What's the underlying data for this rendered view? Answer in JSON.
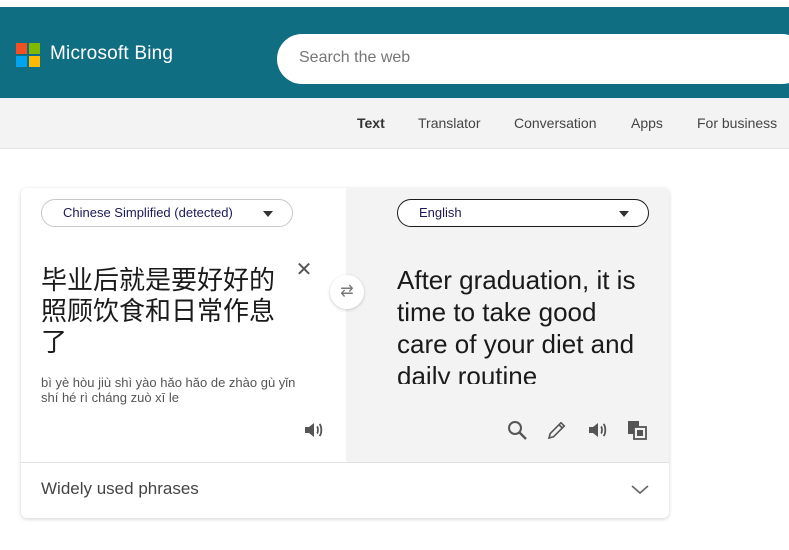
{
  "brand": {
    "name": "Microsoft Bing",
    "logo_colors": [
      "#f25022",
      "#7fba00",
      "#00a4ef",
      "#ffb900"
    ]
  },
  "search": {
    "placeholder": "Search the web",
    "value": ""
  },
  "subnav": {
    "items": [
      {
        "label": "Text",
        "active": true
      },
      {
        "label": "Translator",
        "active": false
      },
      {
        "label": "Conversation",
        "active": false
      },
      {
        "label": "Apps",
        "active": false
      },
      {
        "label": "For business",
        "active": false
      }
    ]
  },
  "translator": {
    "source_language": "Chinese Simplified (detected)",
    "target_language": "English",
    "source_text": "毕业后就是要好好的照顾饮食和日常作息了",
    "pinyin": "bì yè hòu jiù shì yào hǎo hǎo de zhào gù yǐn shí hé rì cháng zuò xī le",
    "target_text": "After graduation, it is time to take good care of your diet and daily routine",
    "icons": {
      "clear": "close-icon",
      "swap": "swap-icon",
      "source_speaker": "speaker-icon",
      "search": "search-icon",
      "edit": "pencil-icon",
      "target_speaker": "speaker-icon",
      "copy": "copy-icon"
    }
  },
  "phrases": {
    "label": "Widely used phrases"
  },
  "colors": {
    "header": "#0f6e82",
    "subnav": "#f3f3f3",
    "target_pane": "#f3f3f3"
  }
}
